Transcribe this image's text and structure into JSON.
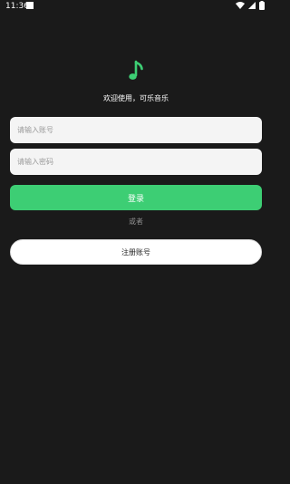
{
  "status_bar": {
    "time": "11:36",
    "icons": [
      "wifi-icon",
      "signal-icon",
      "battery-icon"
    ]
  },
  "app": {
    "logo_icon": "music-note-icon",
    "accent_color": "#3dce74",
    "welcome_text": "欢迎使用，可乐音乐"
  },
  "form": {
    "account_placeholder": "请输入账号",
    "password_placeholder": "请输入密码",
    "login_label": "登录",
    "or_text": "或者",
    "register_label": "注册账号"
  }
}
